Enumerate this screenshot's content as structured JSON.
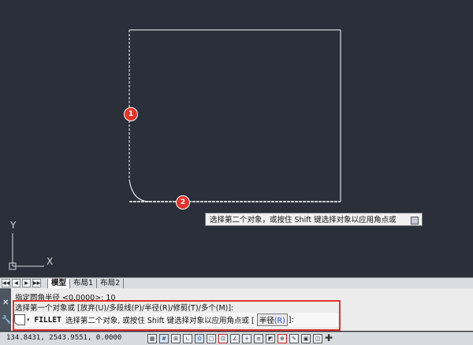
{
  "canvas": {
    "markers": [
      "1",
      "2"
    ],
    "tooltip": "选择第二个对象，或按住 Shift 键选择对象以应用角点或",
    "ucs": {
      "y_label": "Y",
      "x_label": "X"
    }
  },
  "layout_tabs": {
    "nav_buttons": [
      "◀◀",
      "◀",
      "▶",
      "▶▶"
    ],
    "tabs": [
      "模型",
      "布局1",
      "布局2"
    ]
  },
  "command": {
    "history": [
      "指定圆角半径 <0.0000>: 10",
      "选择第一个对象或 [放弃(U)/多段线(P)/半径(R)/修剪(T)/多个(M)]:"
    ],
    "command_name": "FILLET",
    "prompt_text": "选择第二个对象, 或按住 Shift 键选择对象以应用角点或 [",
    "option_label": "半径",
    "option_key": "(R)",
    "prompt_suffix": "]:"
  },
  "status": {
    "coordinates": "134.8431, 2543.9551, 0.0000"
  },
  "colors": {
    "canvas_bg": "#2a2f3a",
    "marker_red": "#e0342d",
    "highlight_red": "#e0342d",
    "option_key_blue": "#2a4fd1"
  }
}
